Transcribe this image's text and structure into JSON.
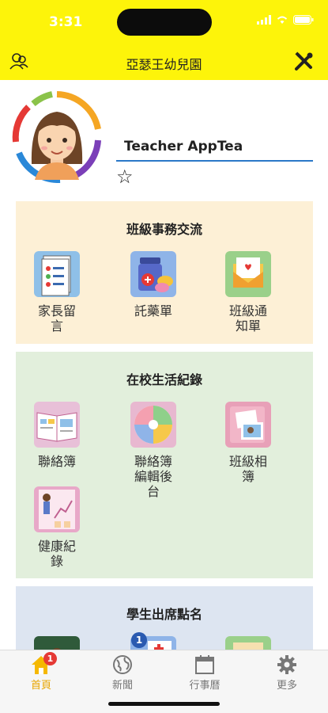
{
  "status": {
    "time": "3:31"
  },
  "header": {
    "title": "亞瑟王幼兒園"
  },
  "profile": {
    "name": "Teacher AppTea"
  },
  "sections": [
    {
      "title": "班級事務交流",
      "items": [
        {
          "label": "家長留言"
        },
        {
          "label": "託藥單"
        },
        {
          "label": "班級通知單"
        }
      ]
    },
    {
      "title": "在校生活紀錄",
      "items": [
        {
          "label": "聯絡簿"
        },
        {
          "label": "聯絡簿編輯後台"
        },
        {
          "label": "班級相簿"
        },
        {
          "label": "健康紀錄"
        }
      ]
    },
    {
      "title": "學生出席點名",
      "badge": "1"
    }
  ],
  "tabs": [
    {
      "label": "首頁",
      "badge": "1"
    },
    {
      "label": "新聞"
    },
    {
      "label": "行事曆"
    },
    {
      "label": "更多"
    }
  ],
  "colors": {
    "header": "#fdf40a",
    "sec1": "#fdf0d6",
    "sec2": "#e2efdc",
    "sec3": "#dde5f1",
    "accent": "#e8a500"
  }
}
